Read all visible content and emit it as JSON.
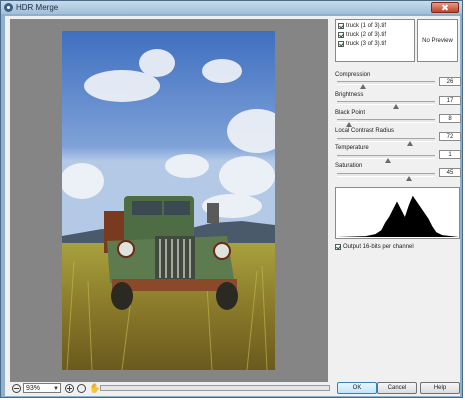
{
  "window": {
    "title": "HDR Merge"
  },
  "files": [
    {
      "label": "truck (1 of 3).tif",
      "checked": true
    },
    {
      "label": "truck (2 of 3).tif",
      "checked": true
    },
    {
      "label": "truck (3 of 3).tif",
      "checked": true
    }
  ],
  "preview_text": "No Preview",
  "sliders": [
    {
      "label": "Compression",
      "value": "26",
      "position": 0.27
    },
    {
      "label": "Brightness",
      "value": "17",
      "position": 0.6
    },
    {
      "label": "Black Point",
      "value": "8",
      "position": 0.12
    },
    {
      "label": "Local Contrast Radius",
      "value": "72",
      "position": 0.74
    },
    {
      "label": "Temperature",
      "value": "1",
      "position": 0.52
    },
    {
      "label": "Saturation",
      "value": "45",
      "position": 0.73
    }
  ],
  "output_option": {
    "label": "Output 16-bits per channel",
    "checked": true
  },
  "zoom": {
    "value": "93%"
  },
  "buttons": {
    "ok": "OK",
    "cancel": "Cancel",
    "help": "Help"
  },
  "icons": {
    "app": "hdr-app-icon",
    "close": "close-icon",
    "zoom_out": "zoom-out-icon",
    "zoom_in": "zoom-in-icon",
    "zoom": "zoom-icon",
    "hand": "hand-icon"
  }
}
